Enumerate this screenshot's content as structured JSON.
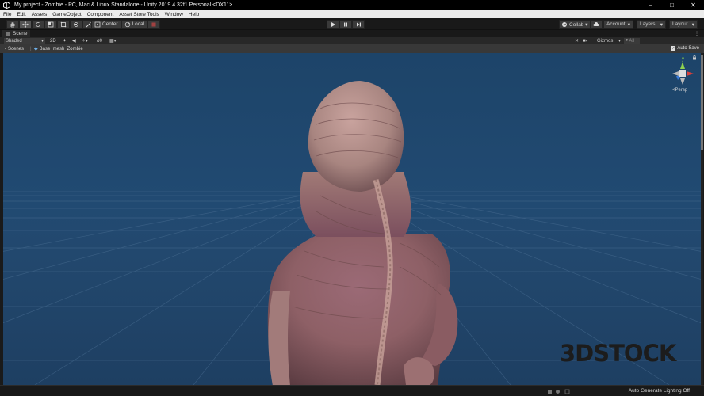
{
  "titlebar": {
    "title": "My project - Zombie - PC, Mac & Linux Standalone - Unity 2019.4.32f1 Personal <DX11>",
    "minimize": "–",
    "maximize": "□",
    "close": "✕"
  },
  "menu": [
    "File",
    "Edit",
    "Assets",
    "GameObject",
    "Component",
    "Asset Store Tools",
    "Window",
    "Help"
  ],
  "toolbar": {
    "pivot_center": "Center",
    "pivot_local": "Local",
    "collab": "Collab ▾",
    "account": "Account",
    "layers": "Layers",
    "layout": "Layout"
  },
  "scene_tab": {
    "label": "Scene"
  },
  "scene_bar": {
    "draw_mode": "Shaded",
    "mode_2d": "2D",
    "fx_count": "0",
    "gizmos": "Gizmos",
    "search_placeholder": "All"
  },
  "breadcrumb": {
    "scenes": "Scenes",
    "object": "Base_mesh_Zombie",
    "auto_save": "Auto Save"
  },
  "gizmo": {
    "y_label": "y",
    "projection": "Persp"
  },
  "watermark": {
    "part1": "3D",
    "part2": "STOCK"
  },
  "status": {
    "lighting": "Auto Generate Lighting Off"
  },
  "colors": {
    "sky": "#1f4670",
    "skin": "#9a6d6b",
    "accent_x": "#d9403a",
    "accent_y": "#8fd14f",
    "accent_z": "#3a7bd9"
  }
}
